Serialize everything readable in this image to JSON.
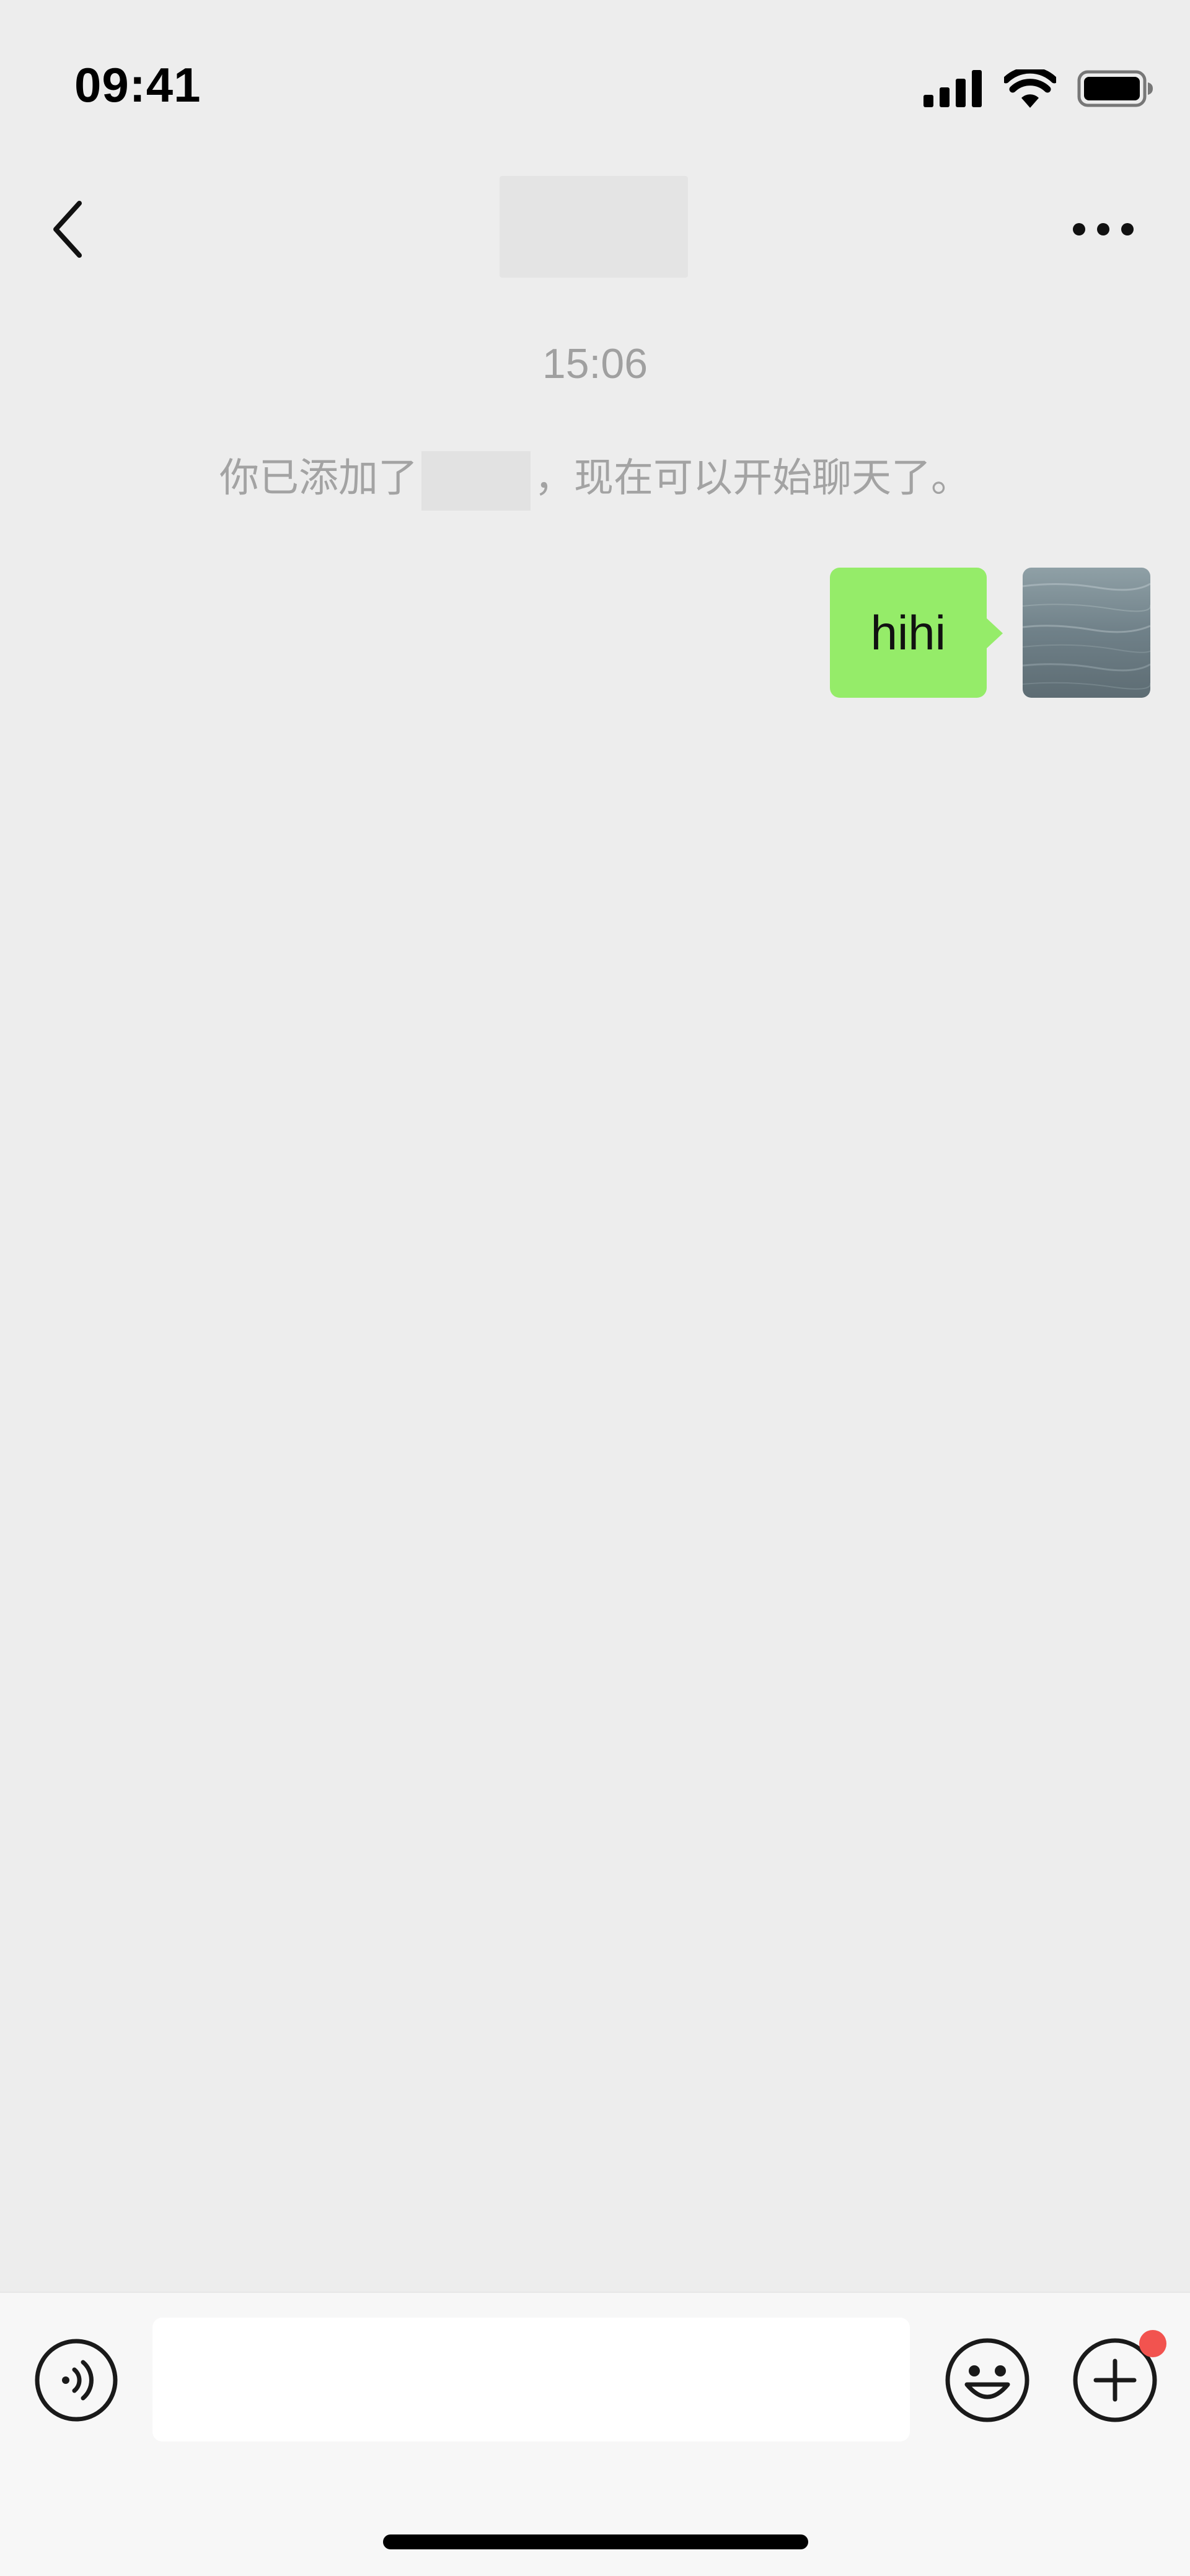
{
  "status_bar": {
    "time": "09:41",
    "icons": [
      "cellular-signal-icon",
      "wifi-icon",
      "battery-icon"
    ]
  },
  "nav": {
    "back_icon": "chevron-left-icon",
    "more_icon": "more-dots-icon"
  },
  "chat": {
    "timestamp": "15:06",
    "system_notice_prefix": "你已添加了",
    "system_notice_suffix": "，现在可以开始聊天了。",
    "messages": [
      {
        "from": "me",
        "text": "hihi"
      }
    ]
  },
  "input_bar": {
    "voice_icon": "voice-icon",
    "emoji_icon": "emoji-icon",
    "plus_icon": "plus-circle-icon",
    "input_value": ""
  },
  "colors": {
    "background": "#ededed",
    "bubble_outgoing": "#95ec69",
    "badge": "#f2534f"
  }
}
